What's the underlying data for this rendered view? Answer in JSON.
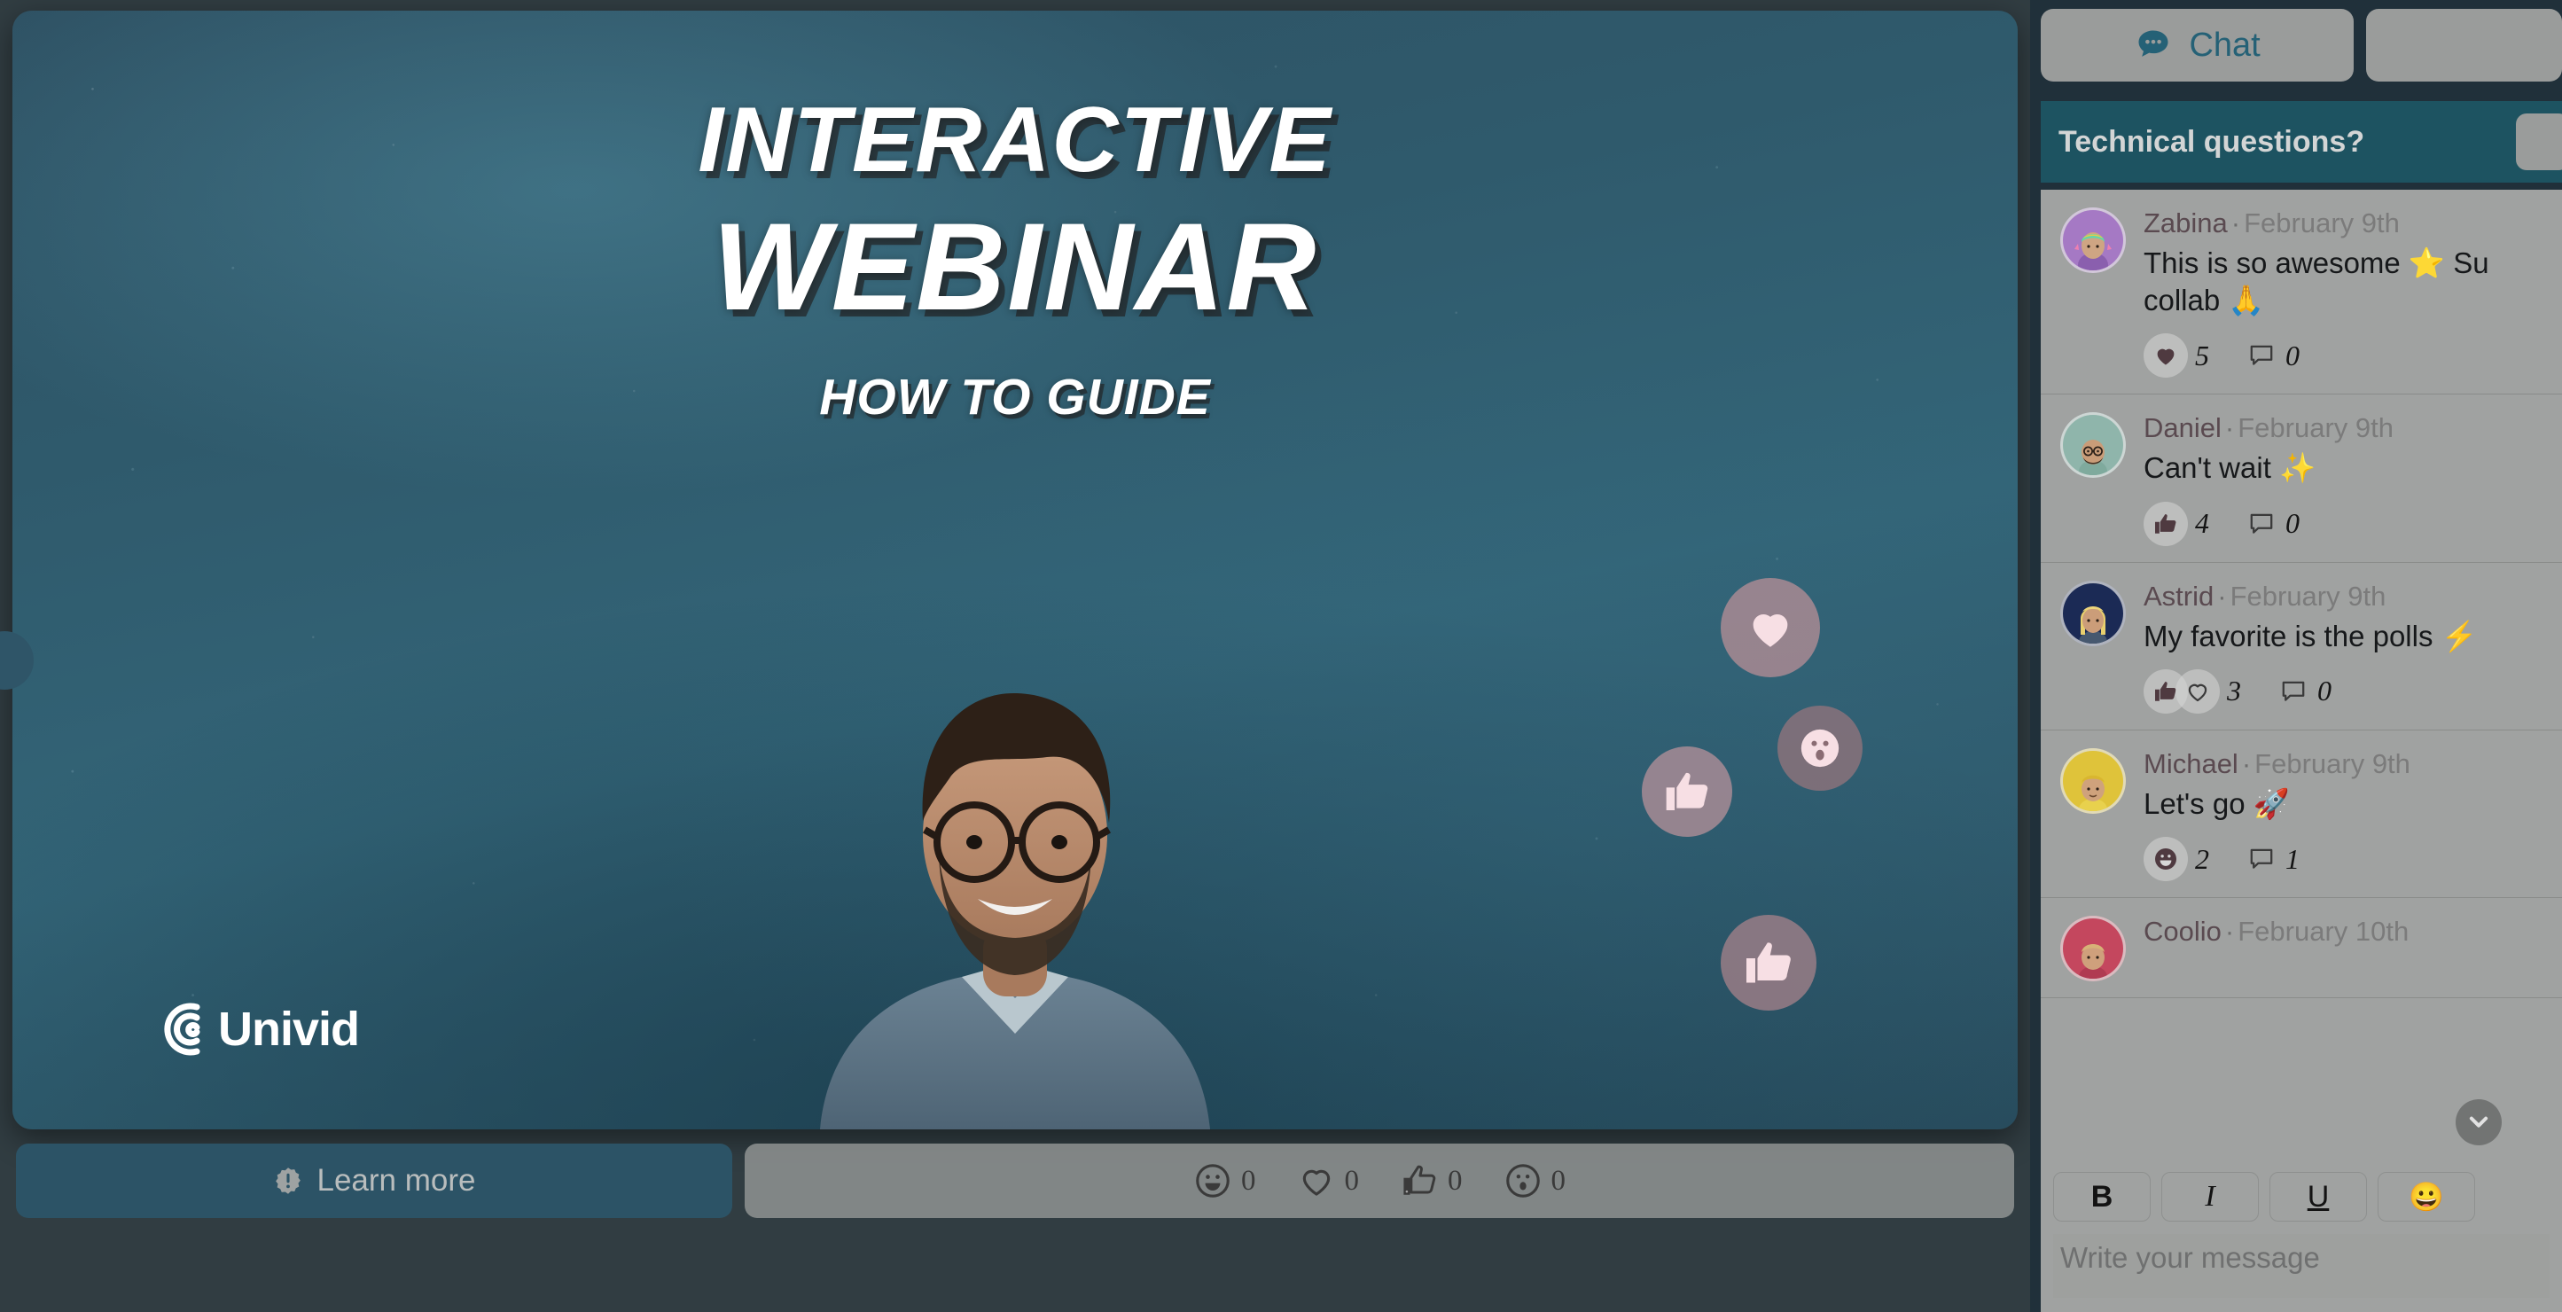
{
  "slide": {
    "title_line1": "INTERACTIVE",
    "title_line2": "WEBINAR",
    "subtitle": "HOW TO GUIDE",
    "logo_text": "Univid",
    "logo_icon": "univid-wave-icon",
    "speaker_alt": "presenter-portrait",
    "floating_reactions": [
      {
        "icon": "heart-icon"
      },
      {
        "icon": "thumbs-up-icon"
      },
      {
        "icon": "wow-face-icon"
      },
      {
        "icon": "thumbs-up-icon"
      }
    ],
    "nav_prev_icon": "chevron-left-icon"
  },
  "controls": {
    "cta_label": "Learn more",
    "cta_icon": "badge-exclamation-icon",
    "reactions": [
      {
        "icon": "smiley-icon",
        "count": "0"
      },
      {
        "icon": "heart-icon",
        "count": "0"
      },
      {
        "icon": "thumbs-up-icon",
        "count": "0"
      },
      {
        "icon": "wow-face-icon",
        "count": "0"
      }
    ]
  },
  "chat": {
    "tabs": [
      {
        "label": "Chat",
        "icon": "chat-bubble-icon",
        "active": true
      },
      {
        "label": "",
        "icon": "",
        "active": false
      }
    ],
    "banner": {
      "text": "Technical questions?",
      "action_icon": "banner-action-icon"
    },
    "messages": [
      {
        "author": "Zabina",
        "date": "February 9th",
        "text": "This is so awesome ⭐ Su",
        "text_wrap": "collab 🙏",
        "avatar_color": "#a579c4",
        "reactions": [
          {
            "icon": "heart-filled-icon"
          }
        ],
        "reaction_count": "5",
        "comment_count": "0"
      },
      {
        "author": "Daniel",
        "date": "February 9th",
        "text": "Can't wait ✨",
        "avatar_color": "#8fb5ab",
        "reactions": [
          {
            "icon": "thumbs-up-filled-icon"
          }
        ],
        "reaction_count": "4",
        "comment_count": "0"
      },
      {
        "author": "Astrid",
        "date": "February 9th",
        "text": "My favorite is the polls ⚡",
        "avatar_color": "#1b2a55",
        "reactions": [
          {
            "icon": "thumbs-up-filled-icon"
          },
          {
            "icon": "heart-outline-icon"
          }
        ],
        "reaction_count": "3",
        "comment_count": "0"
      },
      {
        "author": "Michael",
        "date": "February 9th",
        "text": "Let's go 🚀",
        "avatar_color": "#dfc33a",
        "reactions": [
          {
            "icon": "smiley-filled-icon"
          }
        ],
        "reaction_count": "2",
        "comment_count": "1"
      },
      {
        "author": "Coolio",
        "date": "February 10th",
        "text": "",
        "avatar_color": "#c4475e",
        "reactions": [],
        "reaction_count": "",
        "comment_count": ""
      }
    ],
    "scroll_down_icon": "chevron-down-icon",
    "composer": {
      "bold_label": "B",
      "italic_label": "I",
      "underline_label": "U",
      "emoji_label": "😀",
      "placeholder": "Write your message"
    }
  },
  "colors": {
    "accent_teal": "#1d5361",
    "panel_gray": "#a0a2a1",
    "tab_text": "#256176",
    "slide_bg": "#2f5a6c"
  }
}
